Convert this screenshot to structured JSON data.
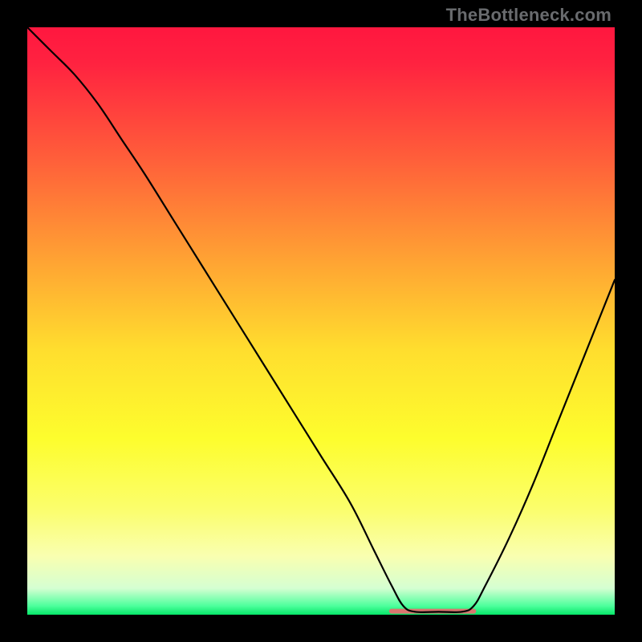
{
  "watermark": "TheBottleneck.com",
  "chart_data": {
    "type": "line",
    "title": "",
    "xlabel": "",
    "ylabel": "",
    "xlim": [
      0,
      100
    ],
    "ylim": [
      0,
      100
    ],
    "grid": false,
    "legend": false,
    "background": {
      "type": "vertical-gradient",
      "stops": [
        {
          "pos": 0.0,
          "color": "#ff173f"
        },
        {
          "pos": 0.06,
          "color": "#ff2240"
        },
        {
          "pos": 0.22,
          "color": "#ff5d3a"
        },
        {
          "pos": 0.4,
          "color": "#ffa433"
        },
        {
          "pos": 0.55,
          "color": "#ffde2e"
        },
        {
          "pos": 0.7,
          "color": "#fdfd2d"
        },
        {
          "pos": 0.82,
          "color": "#fbfe6c"
        },
        {
          "pos": 0.9,
          "color": "#f9ffb0"
        },
        {
          "pos": 0.955,
          "color": "#d5ffd2"
        },
        {
          "pos": 0.985,
          "color": "#4dff9c"
        },
        {
          "pos": 1.0,
          "color": "#06e669"
        }
      ]
    },
    "series": [
      {
        "name": "bottleneck-curve",
        "color": "#000000",
        "width": 2.2,
        "x": [
          0.0,
          4.0,
          8.0,
          12.0,
          16.0,
          20.0,
          25.0,
          30.0,
          35.0,
          40.0,
          45.0,
          50.0,
          55.0,
          59.0,
          62.0,
          64.0,
          66.0,
          70.0,
          74.0,
          76.0,
          78.0,
          82.0,
          86.0,
          90.0,
          94.0,
          98.0,
          100.0
        ],
        "y": [
          100.0,
          96.0,
          92.0,
          87.0,
          81.0,
          75.0,
          67.0,
          59.0,
          51.0,
          43.0,
          35.0,
          27.0,
          19.0,
          11.0,
          5.0,
          1.5,
          0.5,
          0.5,
          0.5,
          1.5,
          5.0,
          13.0,
          22.0,
          32.0,
          42.0,
          52.0,
          57.0
        ]
      },
      {
        "name": "optimal-plateau",
        "color": "#d9766f",
        "width": 6,
        "x": [
          62.0,
          76.0
        ],
        "y": [
          0.6,
          0.6
        ]
      }
    ],
    "annotations": []
  }
}
